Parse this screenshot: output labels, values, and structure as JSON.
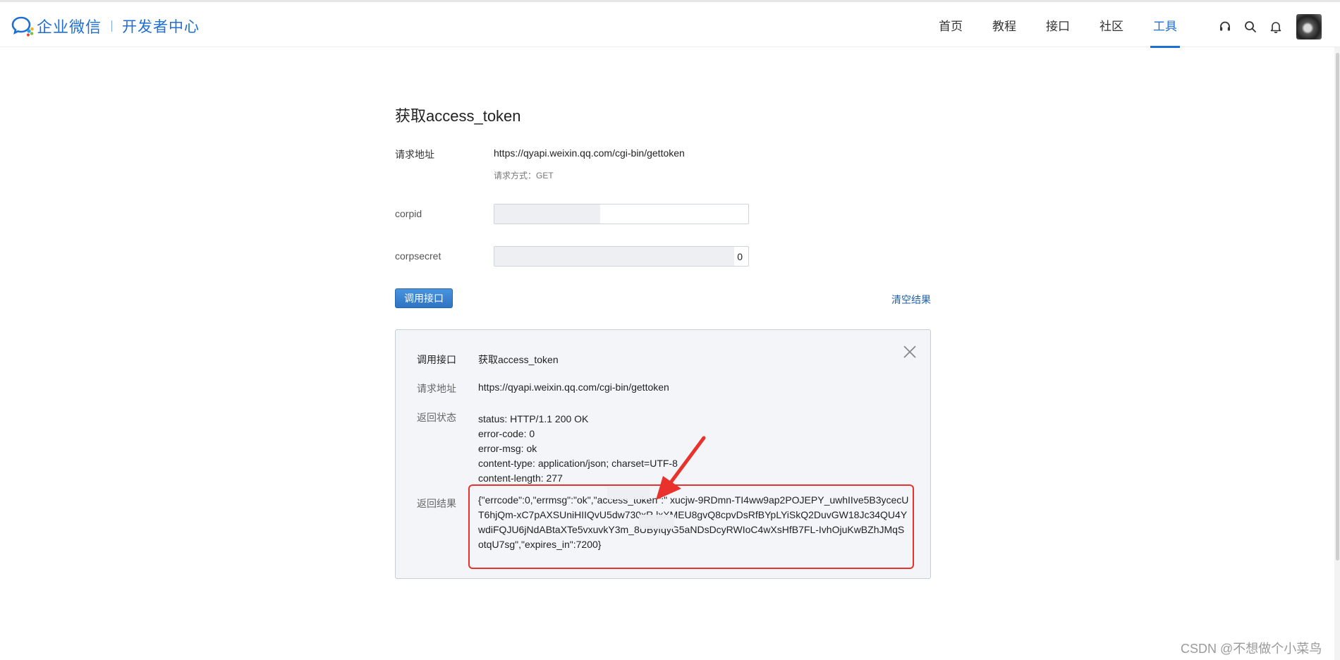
{
  "header": {
    "brand": "企业微信",
    "subtitle": "开发者中心",
    "nav": [
      {
        "label": "首页",
        "active": false
      },
      {
        "label": "教程",
        "active": false
      },
      {
        "label": "接口",
        "active": false
      },
      {
        "label": "社区",
        "active": false
      },
      {
        "label": "工具",
        "active": true
      }
    ],
    "icons": [
      "headset-icon",
      "search-icon",
      "bell-icon"
    ],
    "accent_color": "#1f6ed4"
  },
  "form": {
    "title": "获取access_token",
    "request_url_label": "请求地址",
    "request_url": "https://qyapi.weixin.qq.com/cgi-bin/gettoken",
    "request_method": "请求方式：GET",
    "corpid_label": "corpid",
    "corpid_value": "",
    "corpsecret_label": "corpsecret",
    "corpsecret_value": "0",
    "call_button": "调用接口",
    "clear_link": "清空结果"
  },
  "result": {
    "api_label": "调用接口",
    "api_value": "获取access_token",
    "url_label": "请求地址",
    "url_value": "https://qyapi.weixin.qq.com/cgi-bin/gettoken",
    "status_label": "返回状态",
    "status_lines": [
      "status: HTTP/1.1 200 OK",
      "error-code: 0",
      "error-msg: ok",
      "content-type: application/json; charset=UTF-8",
      "content-length: 277"
    ],
    "result_label": "返回结果",
    "result_json": "{\"errcode\":0,\"errmsg\":\"ok\",\"access_token\":\"           xucjw-9RDmn-TI4ww9ap2POJEPY_uwhIIve5B3ycecUT6hjQm-xC7pAXSUniHIIQvU5dw730xR           lxXMEU8gvQ8cpvDsRfBYpLYiSkQ2DuvGW18Jc34QU4YwdiFQJU6jNdABtaXTe5vxuvkY3m_8UByfqyG5aNDsDcyRWIoC4wXsHfB7FL-IvhOjuKwBZhJMqSotqU7sg\",\"expires_in\":7200}",
    "highlight_color": "#e8322b"
  },
  "watermark": "CSDN @不想做个小菜鸟"
}
